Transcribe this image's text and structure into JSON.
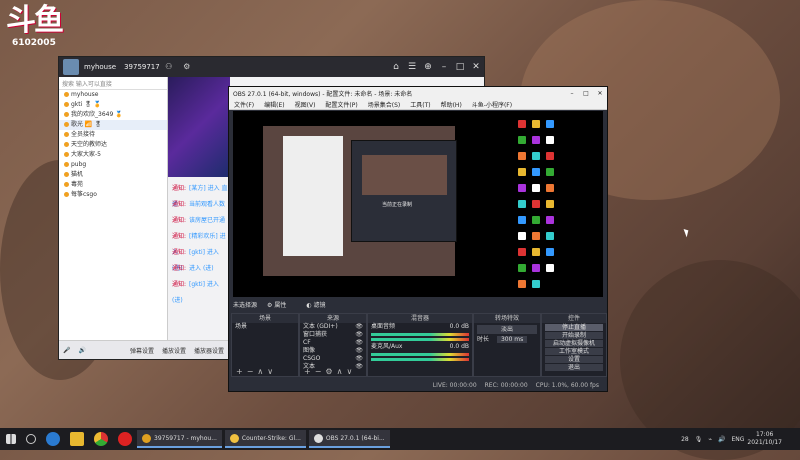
{
  "watermark": {
    "logo": "斗鱼",
    "room_id": "6102005"
  },
  "room_app": {
    "title": "myhouse",
    "room_number": "39759717",
    "left_panel": {
      "search_text": "搜索 输入可以直接",
      "users": [
        {
          "name": "myhouse",
          "selected": false
        },
        {
          "name": "gkti 🎖 🏅",
          "selected": false
        },
        {
          "name": "我的欢欣_3649 🏅",
          "selected": false
        },
        {
          "name": "歌光 📶 🎖",
          "selected": true
        },
        {
          "name": "全员接待",
          "selected": false
        },
        {
          "name": "天空的教师达",
          "selected": false
        },
        {
          "name": "大家大家-5",
          "selected": false
        },
        {
          "name": "pubg",
          "selected": false
        },
        {
          "name": "猫机",
          "selected": false
        },
        {
          "name": "毒苑",
          "selected": false
        },
        {
          "name": "每筝csgo",
          "selected": false
        }
      ]
    },
    "chat_messages": [
      {
        "prefix": "通知:",
        "text": "[某方] 进入 直播"
      },
      {
        "prefix": "通知:",
        "text": "当前观看人数"
      },
      {
        "prefix": "通知:",
        "text": "该房屋已开通"
      },
      {
        "prefix": "通知:",
        "text": "[精彩欢乐] 进入"
      },
      {
        "prefix": "通知:",
        "text": "[gkti] 进入 (进)"
      },
      {
        "prefix": "通知:",
        "text": "进入 (进)"
      },
      {
        "prefix": "通知:",
        "text": "[gkti] 进入 (进)"
      }
    ],
    "bottom_bar": {
      "items": [
        "弹幕设置",
        "播放设置",
        "播放器设置"
      ]
    }
  },
  "obs": {
    "title": "OBS 27.0.1 (64-bit, windows) - 配置文件: 未命名 - 场景: 未命名",
    "menu": [
      "文件(F)",
      "编辑(E)",
      "视图(V)",
      "配置文件(P)",
      "场景集合(S)",
      "工具(T)",
      "帮助(H)",
      "斗鱼-小程序(F)"
    ],
    "no_source": "未选择源",
    "properties": "属性",
    "filters": "滤镜",
    "docks": {
      "scenes": {
        "title": "场景",
        "items": [
          "场景"
        ]
      },
      "sources": {
        "title": "来源",
        "items": [
          "文本 (GDI+)",
          "窗口捕获",
          "CF",
          "图像",
          "CSGO",
          "文本"
        ]
      },
      "mixer": {
        "title": "混音器",
        "channels": [
          {
            "name": "桌面音频",
            "db": "0.0 dB"
          },
          {
            "name": "麦克风/Aux",
            "db": "0.0 dB"
          }
        ]
      },
      "transitions": {
        "title": "转场特效",
        "mode": "淡出",
        "duration_label": "时长",
        "duration": "300 ms"
      },
      "controls": {
        "title": "控件",
        "buttons": [
          "停止直播",
          "开始录制",
          "启动虚拟摄像机",
          "工作室模式",
          "设置",
          "退出"
        ]
      }
    },
    "status": {
      "live": "LIVE: 00:00:00",
      "rec": "REC: 00:00:00",
      "cpu": "CPU: 1.0%, 60.00 fps"
    },
    "nested_caption": "当前正在录制"
  },
  "taskbar": {
    "apps": [
      {
        "label": "39759717 - myhou...",
        "color": "#e0a020"
      },
      {
        "label": "Counter-Strike: Gl...",
        "color": "#f0c040"
      },
      {
        "label": "OBS 27.0.1 (64-bi...",
        "color": "#ddd"
      }
    ],
    "tray": {
      "lang": "ENG",
      "time": "17:06",
      "date": "2021/10/17",
      "num": "28"
    }
  }
}
